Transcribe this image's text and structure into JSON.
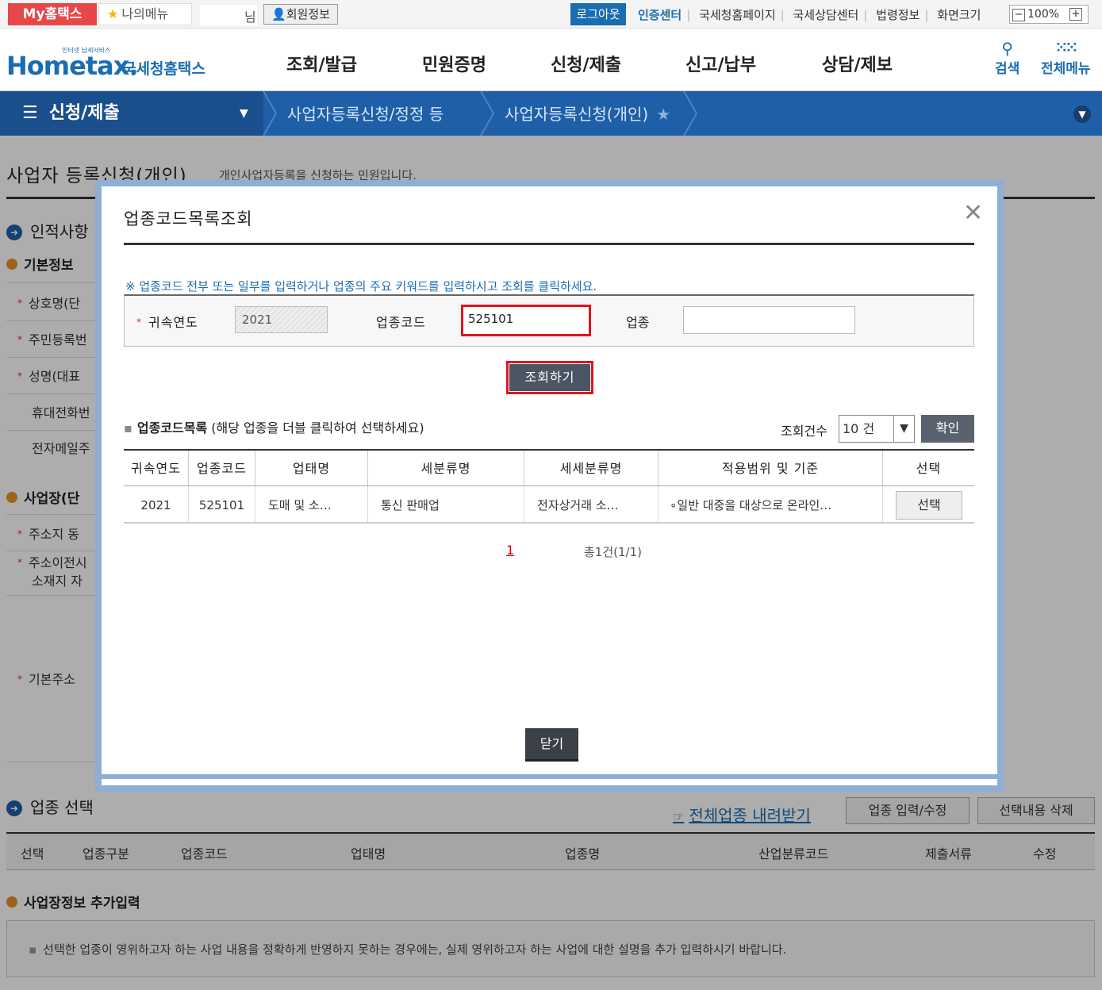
{
  "topbar": {
    "my_home": "My홈택스",
    "my_menu": "나의메뉴",
    "user_suffix": "님",
    "member_info": "회원정보",
    "logout": "로그아웃",
    "cert_center": "인증센터",
    "links": [
      "국세청홈페이지",
      "국세상담센터",
      "법령정보",
      "화면크기"
    ],
    "zoom_minus": "−",
    "zoom_level": "100%",
    "zoom_plus": "+"
  },
  "header": {
    "logo_small": "인터넷 납세서비스",
    "logo_main": "Hometax.",
    "logo_kor": "국세청홈택스",
    "nav": [
      "조회/발급",
      "민원증명",
      "신청/제출",
      "신고/납부",
      "상담/제보"
    ],
    "search": "검색",
    "all_menu": "전체메뉴"
  },
  "breadcrumb": {
    "menu": "신청/제출",
    "level1": "사업자등록신청/정정 등",
    "level2": "사업자등록신청(개인)"
  },
  "page": {
    "title": "사업자 등록신청(개인)",
    "desc": "개인사업자등록을 신청하는 민원입니다.",
    "section_personal": "인적사항",
    "basic_info": "기본정보",
    "fields": [
      "상호명(단",
      "주민등록번",
      "성명(대표",
      "휴대전화번",
      "전자메일주"
    ],
    "business_site": "사업장(단",
    "address": "주소지 동",
    "address_move_1": "주소이전시",
    "address_move_2": "소재지 자",
    "base_address": "기본주소",
    "section_industry": "업종 선택",
    "download_all": "전체업종 내려받기",
    "btn_input": "업종 입력/수정",
    "btn_delete": "선택내용 삭제",
    "table_headers": [
      "선택",
      "업종구분",
      "업종코드",
      "업태명",
      "업종명",
      "산업분류코드",
      "제출서류",
      "수정"
    ],
    "extra_section": "사업장정보 추가입력",
    "extra_info": "선택한 업종이 영위하고자 하는 사업 내용을 정확하게 반영하지 못하는 경우에는, 실제 영위하고자 하는 사업에 대한 설명을 추가 입력하시기 바랍니다."
  },
  "modal": {
    "title": "업종코드목록조회",
    "notice": "※ 업종코드 전부 또는 일부를 입력하거나 업종의 주요 키워드를 입력하시고 조회를 클릭하세요.",
    "label_year": "귀속연도",
    "year_value": "2021",
    "label_code": "업종코드",
    "code_value": "525101",
    "label_type": "업종",
    "type_value": "",
    "search_btn": "조회하기",
    "list_title": "업종코드목록",
    "list_hint": "(해당 업종을 더블 클릭하여 선택하세요)",
    "count_label": "조회건수",
    "count_value": "10 건",
    "ok_btn": "확인",
    "columns": [
      "귀속연도",
      "업종코드",
      "업태명",
      "세분류명",
      "세세분류명",
      "적용범위 및 기준",
      "선택"
    ],
    "rows": [
      {
        "year": "2021",
        "code": "525101",
        "category": "도매 및 소…",
        "sub": "통신 판매업",
        "subsub": "전자상거래 소…",
        "scope": "∘일반 대중을 대상으로 온라인…",
        "select": "선택"
      }
    ],
    "page_num": "1",
    "page_total": "총1건(1/1)",
    "close_btn": "닫기"
  }
}
